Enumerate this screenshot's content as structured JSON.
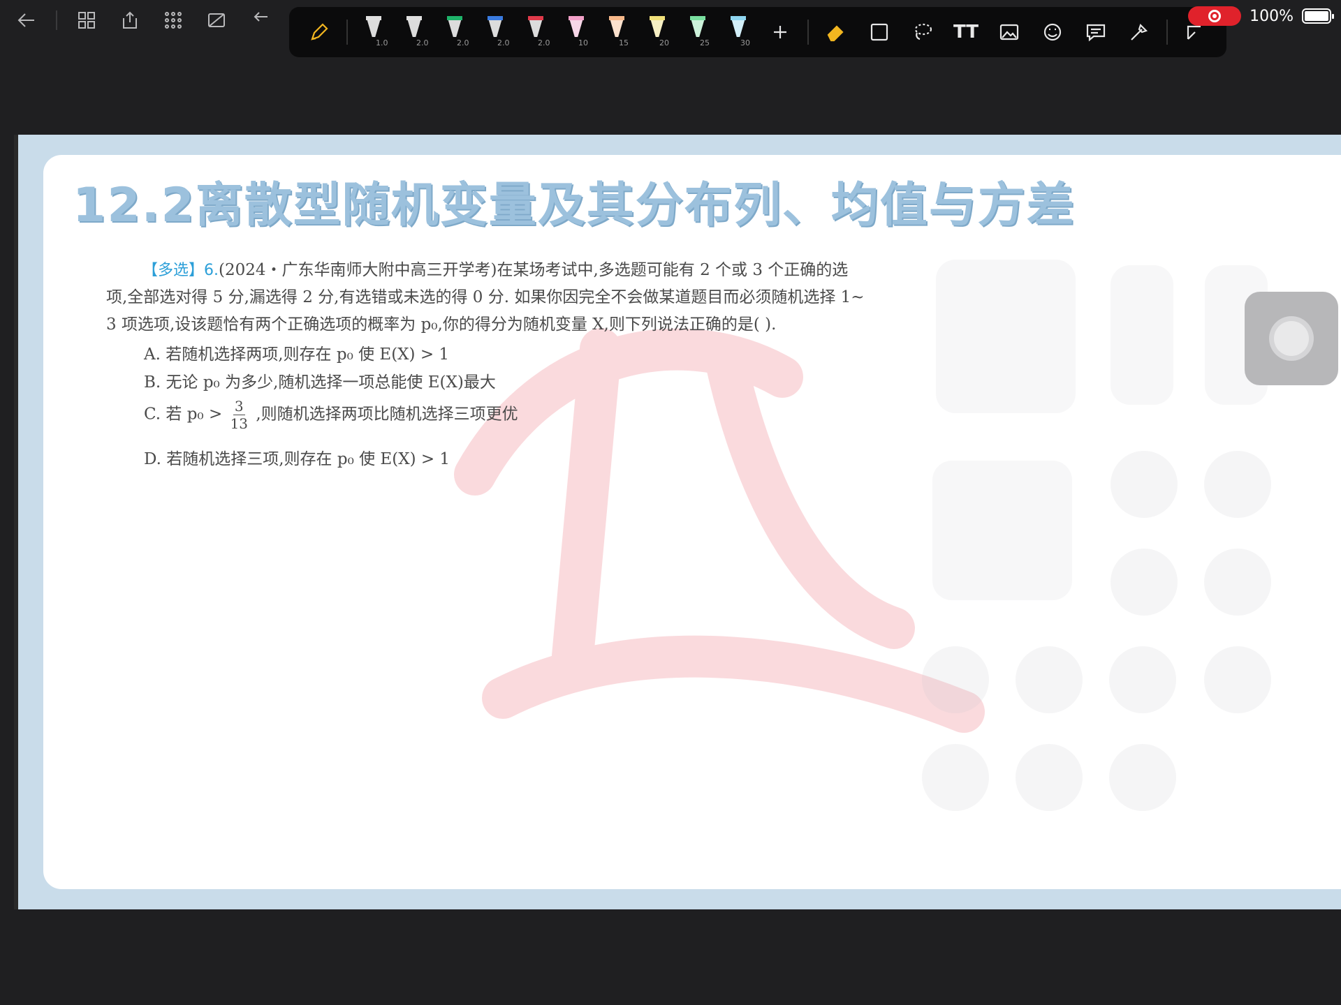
{
  "toolbar": {
    "pens": [
      {
        "size": "1.0",
        "color": "#e0e0e0"
      },
      {
        "size": "2.0",
        "color": "#e0e0e0"
      },
      {
        "size": "2.0",
        "color": "#1fb36a"
      },
      {
        "size": "2.0",
        "color": "#3a7be0"
      },
      {
        "size": "2.0",
        "color": "#e03a4a"
      },
      {
        "size": "10",
        "color": "#f2a0c8"
      },
      {
        "size": "15",
        "color": "#f7b88a"
      },
      {
        "size": "20",
        "color": "#f0e07a"
      },
      {
        "size": "25",
        "color": "#7adfa0"
      },
      {
        "size": "30",
        "color": "#8fd6f0"
      }
    ],
    "text_tool_label": "TT"
  },
  "status": {
    "battery": "100%"
  },
  "document": {
    "chapter_title": "12.2离散型随机变量及其分布列、均值与方差",
    "question_tag": "【多选】6.",
    "question_line1": "(2024・广东华南师大附中高三开学考)在某场考试中,多选题可能有 2 个或 3 个正确的选",
    "question_line2": "项,全部选对得 5 分,漏选得 2 分,有选错或未选的得 0 分. 如果你因完全不会做某道题目而必须随机选择 1~",
    "question_line3": "3 项选项,设该题恰有两个正确选项的概率为 p₀,你的得分为随机变量 X,则下列说法正确的是(        ).",
    "option_a": "A.  若随机选择两项,则存在 p₀ 使 E(X) > 1",
    "option_b": "B.  无论 p₀ 为多少,随机选择一项总能使 E(X)最大",
    "option_c_pre": "C.  若 p₀ >",
    "option_c_num": "3",
    "option_c_den": "13",
    "option_c_post": ",则随机选择两项比随机选择三项更优",
    "option_d": "D.  若随机选择三项,则存在 p₀ 使 E(X) > 1"
  },
  "colors": {
    "accent": "#f2b620",
    "record": "#e0222b",
    "title_blue": "#9cc1dd",
    "tag_blue": "#2c9fd8"
  }
}
